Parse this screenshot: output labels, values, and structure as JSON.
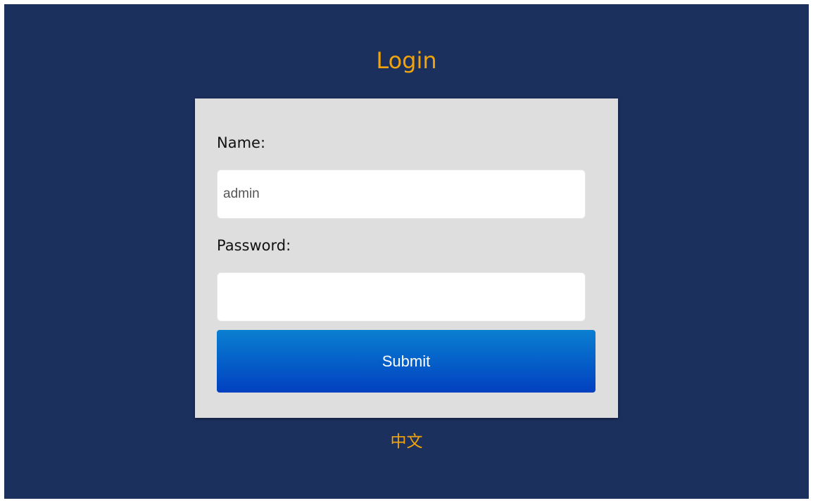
{
  "page": {
    "title": "Login",
    "language_link": "中文"
  },
  "form": {
    "name_label": "Name:",
    "name_value": "admin",
    "password_label": "Password:",
    "password_value": "",
    "submit_label": "Submit"
  },
  "colors": {
    "background": "#1c305e",
    "accent": "#f0a30a",
    "panel": "#dedede",
    "button": "#0560c9"
  }
}
